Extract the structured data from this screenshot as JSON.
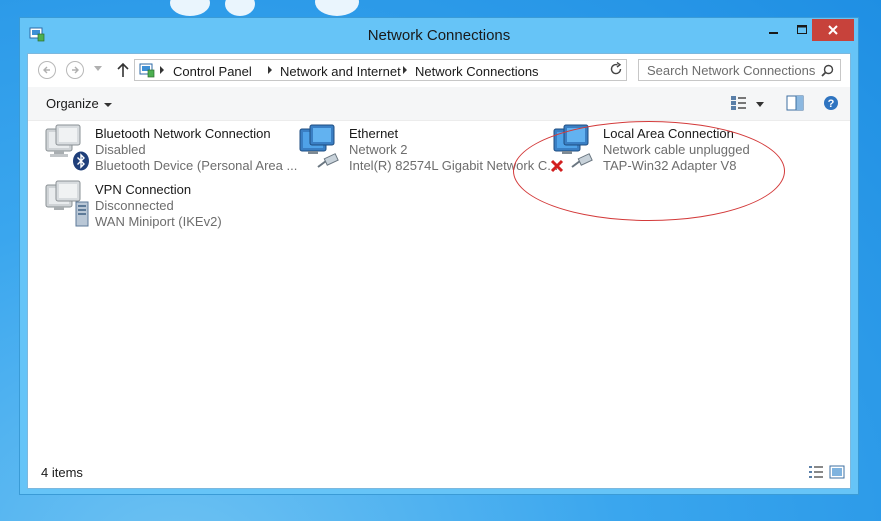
{
  "window": {
    "title": "Network Connections"
  },
  "address_bar": {
    "crumbs": [
      "Control Panel",
      "Network and Internet",
      "Network Connections"
    ],
    "search_placeholder": "Search Network Connections"
  },
  "command_bar": {
    "organize_label": "Organize"
  },
  "connections": [
    {
      "name": "Bluetooth Network Connection",
      "status": "Disabled",
      "device": "Bluetooth Device (Personal Area ...",
      "badge": "bluetooth-icon"
    },
    {
      "name": "Ethernet",
      "status": "Network  2",
      "device": "Intel(R) 82574L Gigabit Network C...",
      "badge": "network-cable-icon"
    },
    {
      "name": "Local Area Connection",
      "status": "Network cable unplugged",
      "device": "TAP-Win32 Adapter V8",
      "badge": "unplugged-x-icon"
    },
    {
      "name": "VPN Connection",
      "status": "Disconnected",
      "device": "WAN Miniport (IKEv2)",
      "badge": "vpn-server-icon"
    }
  ],
  "status_bar": {
    "item_count": "4 items"
  },
  "colors": {
    "title_bar": "#66c4f7",
    "close_button": "#c7423b",
    "annotation_ellipse": "#d33a3a"
  }
}
